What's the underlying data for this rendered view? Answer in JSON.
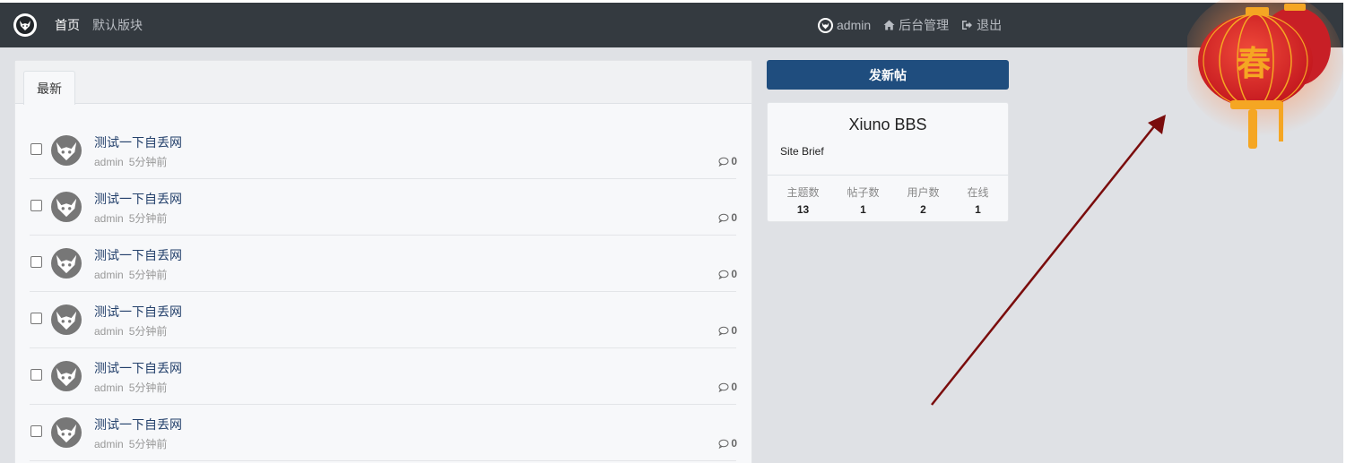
{
  "navbar": {
    "logo_icon": "fox-mascot-icon",
    "home_label": "首页",
    "board_label": "默认版块",
    "user_label": "admin",
    "admin_label": "后台管理",
    "logout_label": "退出"
  },
  "main": {
    "tabs": [
      {
        "label": "最新"
      }
    ],
    "threads": [
      {
        "title": "测试一下自丢网",
        "author": "admin",
        "time": "5分钟前",
        "replies": "0"
      },
      {
        "title": "测试一下自丢网",
        "author": "admin",
        "time": "5分钟前",
        "replies": "0"
      },
      {
        "title": "测试一下自丢网",
        "author": "admin",
        "time": "5分钟前",
        "replies": "0"
      },
      {
        "title": "测试一下自丢网",
        "author": "admin",
        "time": "5分钟前",
        "replies": "0"
      },
      {
        "title": "测试一下自丢网",
        "author": "admin",
        "time": "5分钟前",
        "replies": "0"
      },
      {
        "title": "测试一下自丢网",
        "author": "admin",
        "time": "5分钟前",
        "replies": "0"
      }
    ]
  },
  "sidebar": {
    "new_thread_label": "发新帖",
    "site_name": "Xiuno BBS",
    "site_brief": "Site Brief",
    "stats": [
      {
        "label": "主题数",
        "value": "13"
      },
      {
        "label": "帖子数",
        "value": "1"
      },
      {
        "label": "用户数",
        "value": "2"
      },
      {
        "label": "在线",
        "value": "1"
      }
    ]
  },
  "decoration": {
    "lantern_char": "春"
  },
  "colors": {
    "navbar_bg": "#343a40",
    "primary_button": "#1f4d7e",
    "link_title": "#23406b",
    "annotation_arrow": "#7a0c0c",
    "lantern_red": "#d8222b",
    "lantern_gold": "#f5a623"
  }
}
